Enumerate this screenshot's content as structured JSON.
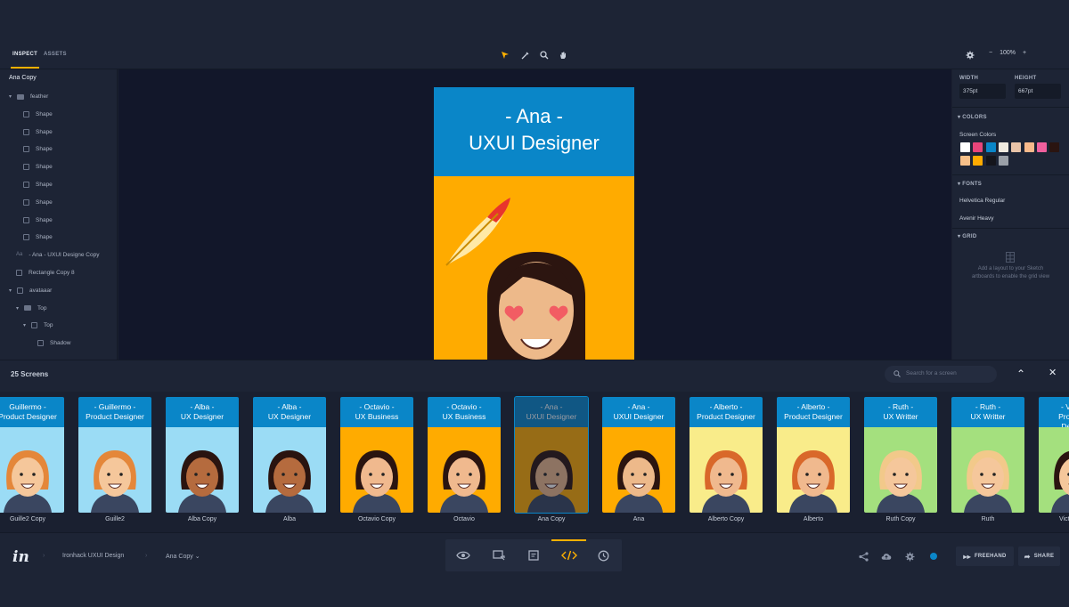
{
  "tabs": {
    "inspect": "INSPECT",
    "assets": "ASSETS"
  },
  "zoom": {
    "minus": "−",
    "value": "100%",
    "plus": "+"
  },
  "layers": {
    "selected": "Ana Copy",
    "items": [
      "feather",
      "Shape",
      "Shape",
      "Shape",
      "Shape",
      "Shape",
      "Shape",
      "Shape",
      "Shape",
      "- Ana - UXUI Designe Copy",
      "Rectangle Copy 8",
      "avataaar",
      "Top",
      "Top",
      "Shadow"
    ]
  },
  "artboard": {
    "line1": "- Ana -",
    "line2": "UXUI Designer"
  },
  "inspector": {
    "width_label": "WIDTH",
    "width_value": "375pt",
    "height_label": "HEIGHT",
    "height_value": "667pt",
    "colors_label": "COLORS",
    "screen_colors": "Screen Colors",
    "swatches": [
      "#ffffff",
      "#e8457a",
      "#0a86c8",
      "#efeae0",
      "#e8c3a8",
      "#f7b98b",
      "#f0609e",
      "#2a1410",
      "#f7c08a",
      "#ffab00",
      "#14151c",
      "#9aa0a8"
    ],
    "fonts_label": "FONTS",
    "font1": "Helvetica Regular",
    "font2": "Avenir Heavy",
    "grid_label": "GRID",
    "grid_hint1": "Add a layout to your Sketch",
    "grid_hint2": "artboards to enable the grid view"
  },
  "screens": {
    "title": "25 Screens",
    "search_placeholder": "Search for a screen",
    "cards": [
      {
        "l1": "Guillermo -",
        "l2": "Product Designer",
        "name": "Guille2 Copy",
        "bg": "#9bdcf5"
      },
      {
        "l1": "- Guillermo -",
        "l2": "Product Designer",
        "name": "Guille2",
        "bg": "#9bdcf5"
      },
      {
        "l1": "- Alba -",
        "l2": "UX Designer",
        "name": "Alba Copy",
        "bg": "#9bdcf5"
      },
      {
        "l1": "- Alba -",
        "l2": "UX Designer",
        "name": "Alba",
        "bg": "#9bdcf5"
      },
      {
        "l1": "- Octavio -",
        "l2": "UX Business",
        "name": "Octavio Copy",
        "bg": "#ffab00"
      },
      {
        "l1": "- Octavio -",
        "l2": "UX Business",
        "name": "Octavio",
        "bg": "#ffab00"
      },
      {
        "l1": "- Ana -",
        "l2": "UXUI Designer",
        "name": "Ana Copy",
        "bg": "#ffab00"
      },
      {
        "l1": "- Ana -",
        "l2": "UXUI Designer",
        "name": "Ana",
        "bg": "#ffab00"
      },
      {
        "l1": "- Alberto -",
        "l2": "Product Designer",
        "name": "Alberto Copy",
        "bg": "#f9ec8a"
      },
      {
        "l1": "- Alberto -",
        "l2": "Product Designer",
        "name": "Alberto",
        "bg": "#f9ec8a"
      },
      {
        "l1": "- Ruth -",
        "l2": "UX Writter",
        "name": "Ruth Copy",
        "bg": "#a4e07e"
      },
      {
        "l1": "- Ruth -",
        "l2": "UX Writter",
        "name": "Ruth",
        "bg": "#a4e07e"
      },
      {
        "l1": "- Victor -",
        "l2": "Product U",
        "l3": "Designe",
        "name": "Victor Copy",
        "bg": "#a4e07e"
      }
    ]
  },
  "breadcrumb": {
    "project": "Ironhack UXUI Design",
    "screen": "Ana Copy",
    "caret": "⌄"
  },
  "actions": {
    "freehand": "FREEHAND",
    "share": "SHARE"
  },
  "colors": {
    "accent": "#ffb100",
    "brand_blue": "#0a86c8"
  }
}
